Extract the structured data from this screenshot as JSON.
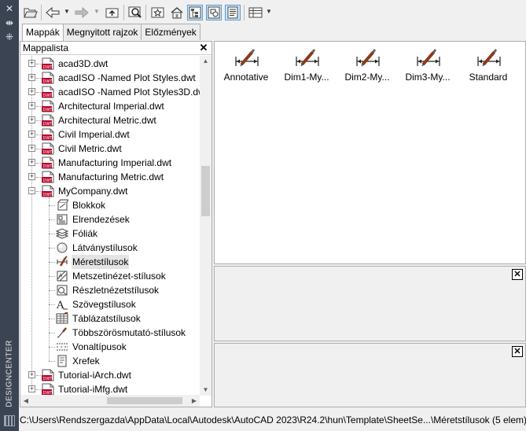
{
  "palette": {
    "title": "DESIGNCENTER",
    "close_glyph": "✕",
    "pin_glyph": "⇼",
    "props_glyph": "⁜"
  },
  "toolbar": {
    "buttons": [
      {
        "name": "open-folder-icon",
        "glyph": "📂"
      },
      {
        "name": "back-icon",
        "glyph": "⇦"
      },
      {
        "name": "forward-icon",
        "glyph": "⇨"
      },
      {
        "name": "up-folder-icon",
        "glyph": "⬆"
      },
      {
        "name": "search-icon",
        "glyph": "🔍"
      },
      {
        "name": "favorites-icon",
        "glyph": "☆"
      },
      {
        "name": "home-icon",
        "glyph": "⌂"
      },
      {
        "name": "tree-view-toggle-icon",
        "glyph": "⊞"
      },
      {
        "name": "preview-toggle-icon",
        "glyph": "▣"
      },
      {
        "name": "description-toggle-icon",
        "glyph": "▤"
      },
      {
        "name": "views-icon",
        "glyph": "☷"
      }
    ],
    "dropdown_glyph": "▼"
  },
  "tabs": [
    {
      "label": "Mappák",
      "active": true
    },
    {
      "label": "Megnyitott rajzok",
      "active": false
    },
    {
      "label": "Előzmények",
      "active": false
    }
  ],
  "tree": {
    "header": "Mappalista",
    "close": "✕",
    "items": [
      {
        "label": "acad3D.dwt",
        "level": 0,
        "expander": "+"
      },
      {
        "label": "acadISO -Named Plot Styles.dwt",
        "level": 0,
        "expander": "+"
      },
      {
        "label": "acadISO -Named Plot Styles3D.dwt",
        "level": 0,
        "expander": "+"
      },
      {
        "label": "Architectural Imperial.dwt",
        "level": 0,
        "expander": "+"
      },
      {
        "label": "Architectural Metric.dwt",
        "level": 0,
        "expander": "+"
      },
      {
        "label": "Civil Imperial.dwt",
        "level": 0,
        "expander": "+"
      },
      {
        "label": "Civil Metric.dwt",
        "level": 0,
        "expander": "+"
      },
      {
        "label": "Manufacturing Imperial.dwt",
        "level": 0,
        "expander": "+"
      },
      {
        "label": "Manufacturing Metric.dwt",
        "level": 0,
        "expander": "+"
      },
      {
        "label": "MyCompany.dwt",
        "level": 0,
        "expander": "−"
      },
      {
        "label": "Blokkok",
        "level": 1,
        "icon": "blocks-icon"
      },
      {
        "label": "Elrendezések",
        "level": 1,
        "icon": "layouts-icon"
      },
      {
        "label": "Fóliák",
        "level": 1,
        "icon": "layers-icon"
      },
      {
        "label": "Látványstílusok",
        "level": 1,
        "icon": "visual-styles-icon"
      },
      {
        "label": "Méretstílusok",
        "level": 1,
        "icon": "dimension-styles-icon",
        "selected": true
      },
      {
        "label": "Metszetinézet-stílusok",
        "level": 1,
        "icon": "section-view-styles-icon"
      },
      {
        "label": "Részletnézetstílusok",
        "level": 1,
        "icon": "detail-view-styles-icon"
      },
      {
        "label": "Szövegstílusok",
        "level": 1,
        "icon": "text-styles-icon"
      },
      {
        "label": "Táblázatstílusok",
        "level": 1,
        "icon": "table-styles-icon"
      },
      {
        "label": "Többszörösmutató-stílusok",
        "level": 1,
        "icon": "multileader-styles-icon"
      },
      {
        "label": "Vonaltípusok",
        "level": 1,
        "icon": "linetypes-icon"
      },
      {
        "label": "Xrefek",
        "level": 1,
        "icon": "xrefs-icon"
      },
      {
        "label": "Tutorial-iArch.dwt",
        "level": 0,
        "expander": "+"
      },
      {
        "label": "Tutorial-iMfg.dwt",
        "level": 0,
        "expander": "+"
      }
    ],
    "dwt_badge": "DWT"
  },
  "content": {
    "items": [
      "Annotative",
      "Dim1-My...",
      "Dim2-My...",
      "Dim3-My...",
      "Standard"
    ]
  },
  "preview": {
    "close": "✕"
  },
  "description": {
    "close": "✕"
  },
  "status": {
    "text": "C:\\Users\\Rendszergazda\\AppData\\Local\\Autodesk\\AutoCAD 2023\\R24.2\\hun\\Template\\SheetSe...\\Méretstílusok (5 elem)"
  },
  "colors": {
    "palette_bar": "#3b4453",
    "selection": "#cce4f7",
    "dwt_red": "#b8002a"
  }
}
